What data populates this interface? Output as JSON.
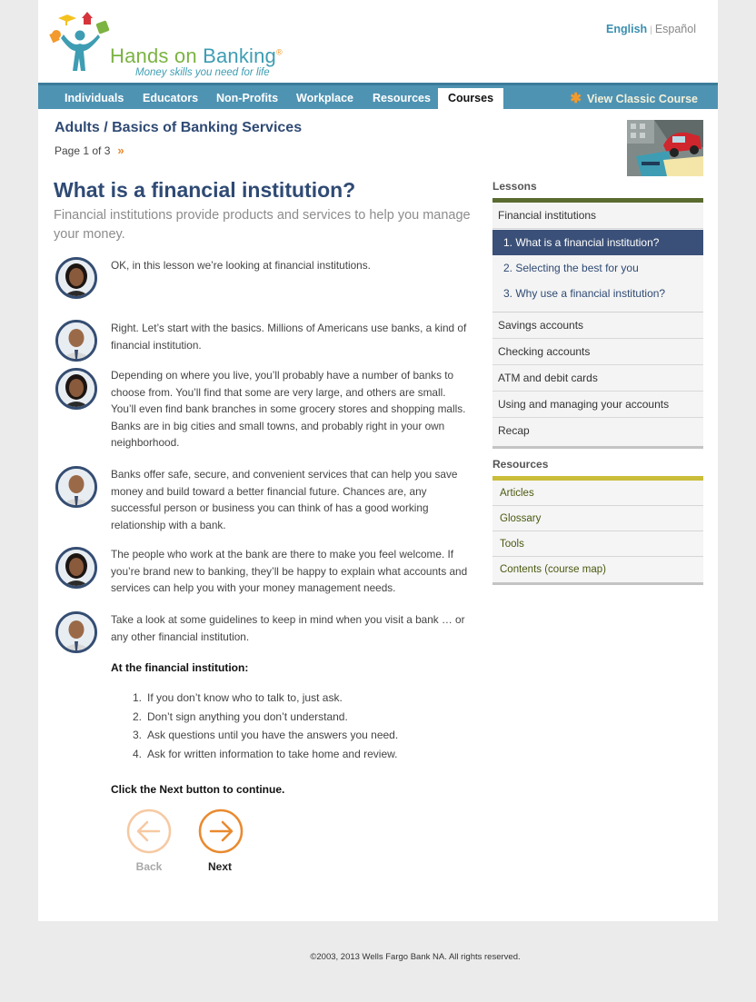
{
  "header": {
    "logo_title_1": "Hands on ",
    "logo_title_2": "Banking",
    "logo_reg": "®",
    "logo_tagline": "Money skills you need for life",
    "lang_english": "English",
    "lang_sep": "|",
    "lang_spanish": "Español"
  },
  "nav": {
    "items": [
      "Individuals",
      "Educators",
      "Non-Profits",
      "Workplace",
      "Resources",
      "Courses"
    ],
    "active": "Courses",
    "classic_label": "View Classic Course"
  },
  "breadcrumb": "Adults / Basics of Banking Services",
  "page_indicator": "Page 1 of 3",
  "lesson": {
    "title": "What is a financial institution?",
    "subtitle": "Financial institutions provide products and services to help you manage your money."
  },
  "dialogue": [
    {
      "speaker": "female",
      "text": "OK, in this lesson we’re looking at financial institutions."
    },
    {
      "speaker": "male",
      "text": "Right. Let’s start with the basics. Millions of Americans use banks, a kind of financial institution."
    },
    {
      "speaker": "female",
      "text": "Depending on where you live, you’ll probably have a number of banks to choose from. You’ll find that some are very large, and others are small. You’ll even find bank branches in some grocery stores and shopping malls. Banks are in big cities and small towns, and probably right in your own neighborhood."
    },
    {
      "speaker": "male",
      "text": "Banks offer safe, secure, and convenient services that can help you save money and build toward a better financial future. Chances are, any successful person or business you can think of has a good working relationship with a bank."
    },
    {
      "speaker": "female",
      "text": "The people who work at the bank are there to make you feel welcome. If you’re brand new to banking, they’ll be happy to explain what accounts and services can help you with your money management needs."
    },
    {
      "speaker": "male",
      "text": "Take a look at some guidelines to keep in mind when you visit a bank … or any other financial institution."
    }
  ],
  "tips": {
    "heading": "At the financial institution:",
    "items": [
      "If you don’t know who to talk to, just ask.",
      "Don’t sign anything you don’t understand.",
      "Ask questions until you have the answers you need.",
      "Ask for written information to take home and review."
    ]
  },
  "next_note": "Click the Next button to continue.",
  "buttons": {
    "back": "Back",
    "next": "Next"
  },
  "sidebar": {
    "lessons_heading": "Lessons",
    "lessons": [
      "Financial institutions",
      "1. What is a financial institution?",
      "2. Selecting the best for you",
      "3. Why use a financial institution?",
      "Savings accounts",
      "Checking accounts",
      "ATM and debit cards",
      "Using and managing your accounts",
      "Recap"
    ],
    "resources_heading": "Resources",
    "resources": [
      "Articles",
      "Glossary",
      "Tools",
      "Contents (course map)"
    ]
  },
  "footer": "©2003, 2013 Wells Fargo Bank NA. All rights reserved.",
  "colors": {
    "nav_bg": "#4f93b3",
    "title_navy": "#2f4a74",
    "accent_orange": "#e98a2f",
    "lessons_bar": "#5a6b2f",
    "resources_bar": "#c9bd3a"
  }
}
